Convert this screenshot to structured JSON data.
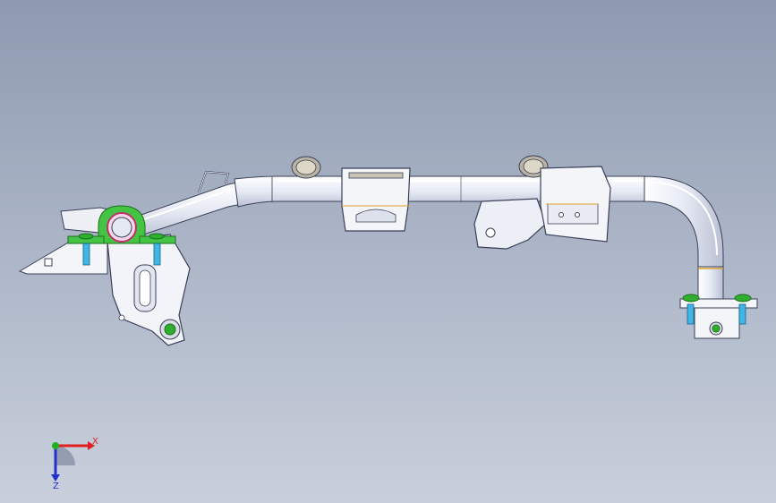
{
  "viewport": {
    "background_top": "#8e9ab0",
    "background_bottom": "#c9d0dc"
  },
  "model": {
    "part": "tube-subframe-assembly",
    "tube_color": "#e8ecf6",
    "edge_color": "#3a3f58",
    "bracket_color": "#f2f4f9",
    "bolt_head_color": "#2fae2f",
    "bolt_shank_color": "#3fb7e6",
    "weld_color": "#e0a030",
    "bushing_color": "#c9b89a"
  },
  "triad": {
    "x_label": "X",
    "z_label": "Z",
    "x_color": "#e02020",
    "y_color": "#20b020",
    "z_color": "#2030d0"
  }
}
